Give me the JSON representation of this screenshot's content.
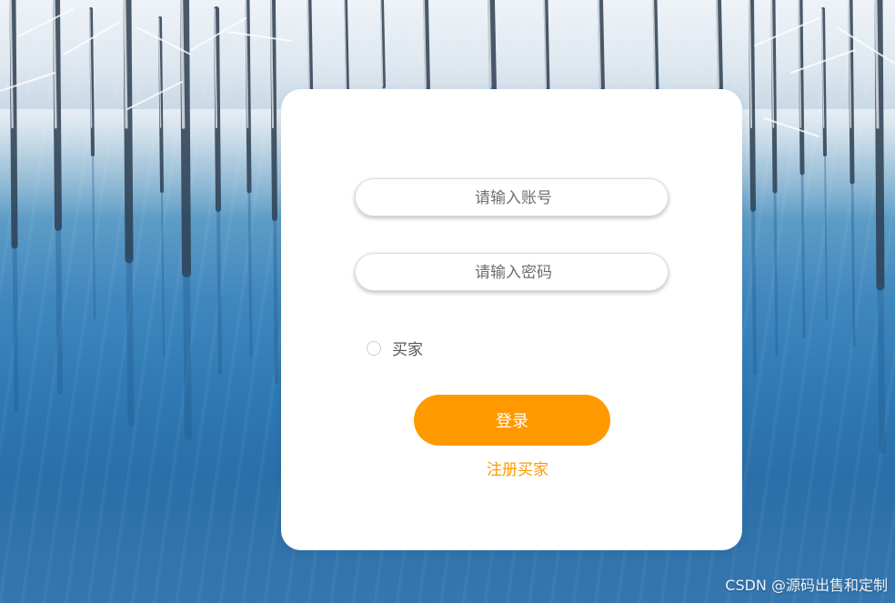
{
  "login_form": {
    "account_placeholder": "请输入账号",
    "password_placeholder": "请输入密码",
    "role_option_label": "买家",
    "login_button_label": "登录",
    "register_link_label": "注册买家"
  },
  "watermark": {
    "text": "CSDN @源码出售和定制"
  },
  "colors": {
    "accent": "#ff9900",
    "card_background": "#ffffff",
    "water_blue": "#2f79b4"
  }
}
